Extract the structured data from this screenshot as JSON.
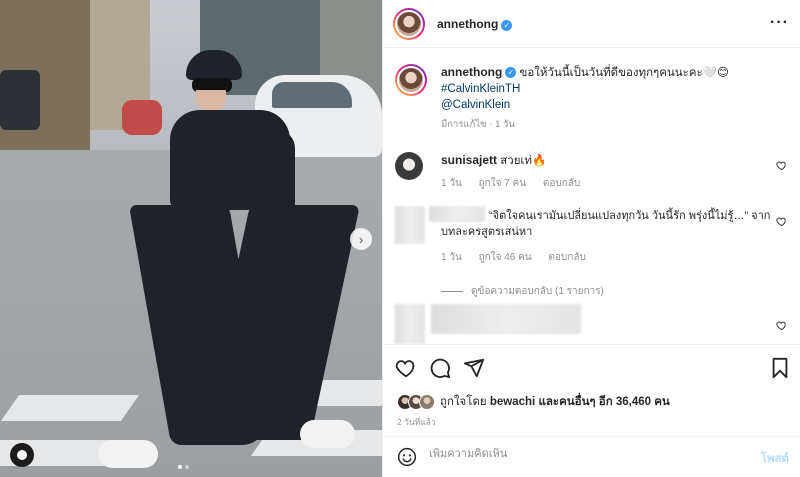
{
  "header": {
    "username": "annethong",
    "more_icon": "more-dots-icon"
  },
  "caption": {
    "username": "annethong",
    "text": "ขอให้วันนี้เป็นวันที่ดีของทุกๆคนนะคะ🤍😊",
    "hashtag": "#CalvinKleinTH",
    "mention": "@CalvinKlein",
    "edited": "มีการแก้ไข",
    "time": "1 วัน"
  },
  "comments": [
    {
      "username": "sunisajett",
      "text": "สวยเท่🔥",
      "time": "1 วัน",
      "likes": "ถูกใจ 7 คน",
      "reply": "ตอบกลับ"
    },
    {
      "username": "",
      "text": "“จิตใจคนเรามันเปลี่ยนแปลงทุกวัน วันนี้รัก พรุ่งนี้ไม่รู้…” จากบทละครสูตรเสน่หา",
      "time": "1 วัน",
      "likes": "ถูกใจ 46 คน",
      "reply": "ตอบกลับ",
      "view_replies": "ดูข้อความตอบกลับ (1 รายการ)"
    }
  ],
  "actions": {
    "liked_by": "ถูกใจโดย",
    "liked_user": "bewachi",
    "and_others": "และคนอื่นๆ อีก 36,460 คน",
    "date": "2 วันที่แล้ว"
  },
  "add_comment": {
    "placeholder": "เพิ่มความคิดเห็น",
    "post_label": "โพสต์"
  },
  "colors": {
    "link": "#00376b",
    "verified": "#3897f0",
    "post_disabled": "#b2dffc",
    "muted": "#8e8e8e"
  }
}
